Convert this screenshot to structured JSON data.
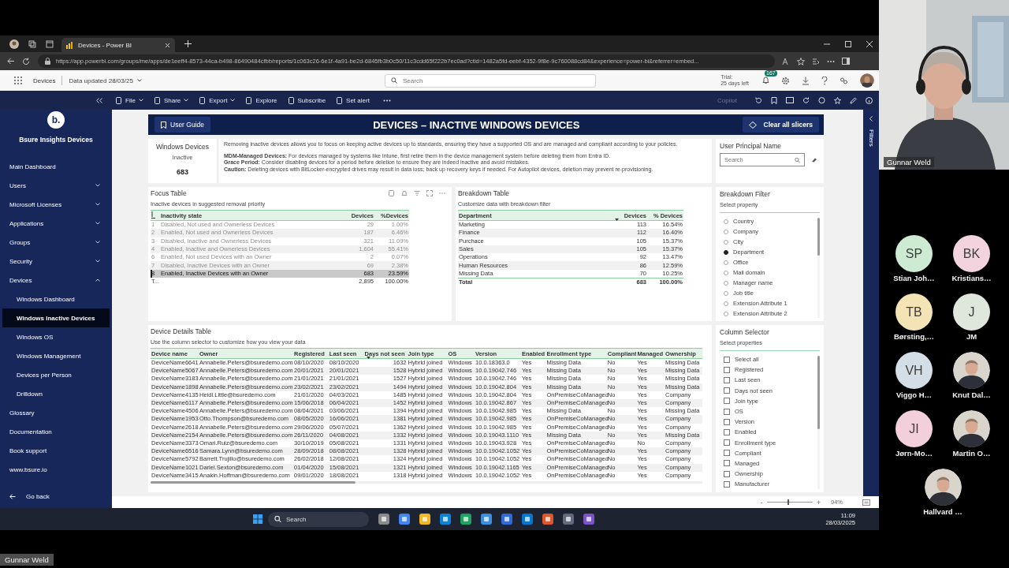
{
  "browser": {
    "tab_title": "Devices - Power BI",
    "url": "https://app.powerbi.com/groups/me/apps/de1eeff4-8573-44ca-b498-86490484cfbb/reports/1c063c26-6e1f-4a91-be2d-6845fb3b0c50/11c3cdd65f222b7ec0ad?ctid=1482a5fd-eebf-4352-9f8e-9c760088cd84&experience=power-bi&referrer=embed..."
  },
  "powerbi_header": {
    "app": "Devices",
    "data_updated": "Data updated 28/03/25",
    "search_placeholder": "Search",
    "trial": "Trial:",
    "trial_days": "25 days left",
    "notifications": "167"
  },
  "report_toolbar": {
    "items": [
      {
        "label": "File",
        "menu": true
      },
      {
        "label": "Share",
        "menu": true
      },
      {
        "label": "Export",
        "menu": true
      },
      {
        "label": "Explore",
        "menu": false
      },
      {
        "label": "Subscribe",
        "menu": false
      },
      {
        "label": "Set alert",
        "menu": false
      }
    ],
    "copilot": "Copilot"
  },
  "sidebar": {
    "brand_mark": "b.",
    "title": "Bsure Insights Devices",
    "items": [
      {
        "label": "Main Dashboard",
        "kind": "page",
        "selected": false
      },
      {
        "label": "Users",
        "kind": "section",
        "expanded": false
      },
      {
        "label": "Microsoft Licenses",
        "kind": "section",
        "expanded": false
      },
      {
        "label": "Applications",
        "kind": "section",
        "expanded": false
      },
      {
        "label": "Groups",
        "kind": "section",
        "expanded": false
      },
      {
        "label": "Security",
        "kind": "section",
        "expanded": false
      },
      {
        "label": "Devices",
        "kind": "section",
        "expanded": true,
        "children": [
          {
            "label": "Windows Dashboard",
            "selected": false
          },
          {
            "label": "Windows Inactive Devices",
            "selected": true
          },
          {
            "label": "Windows OS",
            "selected": false
          },
          {
            "label": "Windows Management",
            "selected": false
          },
          {
            "label": "Devices per Person",
            "selected": false
          },
          {
            "label": "Drilldown",
            "selected": false
          }
        ]
      },
      {
        "label": "Glossary",
        "kind": "page",
        "selected": false
      },
      {
        "label": "Documentation",
        "kind": "page",
        "selected": false
      },
      {
        "label": "Book support",
        "kind": "page",
        "selected": false
      },
      {
        "label": "www.bsure.io",
        "kind": "page",
        "selected": false
      }
    ],
    "back": "Go back"
  },
  "report": {
    "user_guide": "User Guide",
    "title": "DEVICES – INACTIVE WINDOWS DEVICES",
    "clear_slicers": "Clear all slicers",
    "filters": "Filters",
    "kpi": {
      "title": "Windows Devices",
      "subtitle": "Inactive",
      "value": "683"
    },
    "info": {
      "intro": "Removing inactive devices allows you to focus on keeping active devices up to standards, ensuring they have a supported OS and are managed and compliant according to your policies.",
      "notes": [
        "**MDM-Managed Devices:** For devices managed by systems like Intune, first retire them in the device management system before deleting them from Entra ID.",
        "**Grace Period:** Consider disabling devices for a period before deletion to ensure they are indeed inactive and avoid mistakes.",
        "**Caution:** Deleting devices with BitLocker-encrypted drives may result in data loss; back up recovery keys if needed.  For Autopilot devices, deletion may prevent re-provisioning."
      ]
    },
    "upn": {
      "title": "User Principal Name",
      "placeholder": "Search"
    },
    "focus_table": {
      "title": "Focus Table",
      "subtitle": "Inactive devices in suggested removal priority",
      "columns": [
        "Inactivity state",
        "Devices",
        "%Devices"
      ],
      "rows": [
        {
          "index": "1",
          "state": "Disabled, Not used and Ownerless Devices",
          "devices": "29",
          "pct": "1.00%",
          "selected": false
        },
        {
          "index": "2",
          "state": "Enabled, Not used and Ownerless Devices",
          "devices": "187",
          "pct": "6.46%",
          "selected": false
        },
        {
          "index": "3",
          "state": "Disabled, Inactive and Ownerless Devices",
          "devices": "321",
          "pct": "11.09%",
          "selected": false
        },
        {
          "index": "4",
          "state": "Enabled, Inactive and Ownerless Devices",
          "devices": "1,604",
          "pct": "55.41%",
          "selected": false
        },
        {
          "index": "6",
          "state": "Enabled, Not used Devices with an Owner",
          "devices": "2",
          "pct": "0.07%",
          "selected": false
        },
        {
          "index": "7",
          "state": "Disabled, Inactive Devices with an Owner",
          "devices": "69",
          "pct": "2.38%",
          "selected": false
        },
        {
          "index": "8",
          "state": "Enabled, Inactive Devices with an Owner",
          "devices": "683",
          "pct": "23.59%",
          "selected": true
        }
      ],
      "total": {
        "label": "T...",
        "devices": "2,895",
        "pct": "100.00%"
      }
    },
    "breakdown_table": {
      "title": "Breakdown Table",
      "subtitle": "Customize data with breakdown filter",
      "columns": [
        {
          "label": "Department",
          "sorted": false
        },
        {
          "label": "Devices",
          "sorted": true
        },
        {
          "label": "% Devices",
          "sorted": false
        }
      ],
      "rows": [
        [
          "Marketing",
          "113",
          "16.54%"
        ],
        [
          "Finance",
          "112",
          "16.40%"
        ],
        [
          "Purchace",
          "105",
          "15.37%"
        ],
        [
          "Sales",
          "105",
          "15.37%"
        ],
        [
          "Operations",
          "92",
          "13.47%"
        ],
        [
          "Human Resources",
          "86",
          "12.59%"
        ],
        [
          "Missing Data",
          "70",
          "10.25%"
        ]
      ],
      "total": [
        "Total",
        "683",
        "100.00%"
      ]
    },
    "breakdown_filter": {
      "title": "Breakdown Filter",
      "subtitle": "Select property",
      "options": [
        {
          "label": "Country",
          "selected": false
        },
        {
          "label": "Company",
          "selected": false
        },
        {
          "label": "City",
          "selected": false
        },
        {
          "label": "Department",
          "selected": true
        },
        {
          "label": "Office",
          "selected": false
        },
        {
          "label": "Mail domain",
          "selected": false
        },
        {
          "label": "Manager name",
          "selected": false
        },
        {
          "label": "Job title",
          "selected": false
        },
        {
          "label": "Extension Attribute 1",
          "selected": false
        },
        {
          "label": "Extension Attribute 2",
          "selected": false
        }
      ]
    },
    "details_table": {
      "title": "Device Details Table",
      "subtitle": "Use the column selector to customize how you view your data",
      "columns": [
        {
          "label": "Device name",
          "sorted": false
        },
        {
          "label": "Owner",
          "sorted": false
        },
        {
          "label": "Registered",
          "sorted": false
        },
        {
          "label": "Last seen",
          "sorted": false
        },
        {
          "label": "Days not seen",
          "sorted": true
        },
        {
          "label": "Join type",
          "sorted": false
        },
        {
          "label": "OS",
          "sorted": false
        },
        {
          "label": "Version",
          "sorted": false
        },
        {
          "label": "Enabled",
          "sorted": false
        },
        {
          "label": "Enrollment type",
          "sorted": false
        },
        {
          "label": "Compliant",
          "sorted": false
        },
        {
          "label": "Managed",
          "sorted": false
        },
        {
          "label": "Ownership",
          "sorted": false
        }
      ],
      "rows": [
        [
          "DeviceName6641",
          "Annabelle.Peters@bsuredemo.com",
          "08/10/2020",
          "08/10/2020",
          "1632",
          "Hybrid joined",
          "Windows",
          "10.0.18363.0",
          "Yes",
          "Missing Data",
          "No",
          "Yes",
          "Missing Data"
        ],
        [
          "DeviceName5067",
          "Annabelle.Peters@bsuredemo.com",
          "20/01/2021",
          "20/01/2021",
          "1528",
          "Hybrid joined",
          "Windows",
          "10.0.19042.746",
          "Yes",
          "Missing Data",
          "No",
          "Yes",
          "Missing Data"
        ],
        [
          "DeviceName3183",
          "Annabelle.Peters@bsuredemo.com",
          "21/01/2021",
          "21/01/2021",
          "1527",
          "Hybrid joined",
          "Windows",
          "10.0.19042.746",
          "Yes",
          "Missing Data",
          "No",
          "Yes",
          "Missing Data"
        ],
        [
          "DeviceName1898",
          "Annabelle.Peters@bsuredemo.com",
          "23/02/2021",
          "23/02/2021",
          "1494",
          "Hybrid joined",
          "Windows",
          "10.0.19042.804",
          "Yes",
          "Missing Data",
          "No",
          "Yes",
          "Missing Data"
        ],
        [
          "DeviceName4135",
          "Heidi.Little@bsuredemo.com",
          "21/01/2020",
          "04/03/2021",
          "1485",
          "Hybrid joined",
          "Windows",
          "10.0.19042.804",
          "Yes",
          "OnPremiseCoManaged",
          "No",
          "Yes",
          "Company"
        ],
        [
          "DeviceName6117",
          "Annabelle.Peters@bsuredemo.com",
          "15/06/2018",
          "06/04/2021",
          "1452",
          "Hybrid joined",
          "Windows",
          "10.0.19042.867",
          "Yes",
          "OnPremiseCoManaged",
          "No",
          "Yes",
          "Company"
        ],
        [
          "DeviceName4506",
          "Annabelle.Peters@bsuredemo.com",
          "08/04/2021",
          "03/06/2021",
          "1394",
          "Hybrid joined",
          "Windows",
          "10.0.19042.985",
          "Yes",
          "Missing Data",
          "No",
          "Yes",
          "Missing Data"
        ],
        [
          "DeviceName1953",
          "Otto.Thompson@bsuredemo.com",
          "08/05/2020",
          "16/06/2021",
          "1381",
          "Hybrid joined",
          "Windows",
          "10.0.19042.985",
          "Yes",
          "OnPremiseCoManaged",
          "No",
          "Yes",
          "Company"
        ],
        [
          "DeviceName2618",
          "Annabelle.Peters@bsuredemo.com",
          "29/06/2020",
          "05/07/2021",
          "1362",
          "Hybrid joined",
          "Windows",
          "10.0.19042.985",
          "Yes",
          "OnPremiseCoManaged",
          "No",
          "Yes",
          "Company"
        ],
        [
          "DeviceName2154",
          "Annabelle.Peters@bsuredemo.com",
          "26/11/2020",
          "04/08/2021",
          "1332",
          "Hybrid joined",
          "Windows",
          "10.0.19043.1110",
          "Yes",
          "Missing Data",
          "No",
          "Yes",
          "Missing Data"
        ],
        [
          "DeviceName3373",
          "Omari.Ruiz@bsuredemo.com",
          "30/10/2019",
          "05/08/2021",
          "1331",
          "Hybrid joined",
          "Windows",
          "10.0.19043.928",
          "Yes",
          "OnPremiseCoManaged",
          "No",
          "No",
          "Company"
        ],
        [
          "DeviceName6516",
          "Samara.Lynn@bsuredemo.com",
          "28/09/2018",
          "08/08/2021",
          "1328",
          "Hybrid joined",
          "Windows",
          "10.0.19042.1052",
          "Yes",
          "OnPremiseCoManaged",
          "No",
          "Yes",
          "Company"
        ],
        [
          "DeviceName5792",
          "Barrett.Trujillo@bsuredemo.com",
          "26/02/2018",
          "12/08/2021",
          "1324",
          "Hybrid joined",
          "Windows",
          "10.0.19042.1052",
          "Yes",
          "OnPremiseCoManaged",
          "No",
          "Yes",
          "Company"
        ],
        [
          "DeviceName1021",
          "Dariel.Sexton@bsuredemo.com",
          "01/04/2020",
          "15/08/2021",
          "1321",
          "Hybrid joined",
          "Windows",
          "10.0.19042.1165",
          "Yes",
          "OnPremiseCoManaged",
          "No",
          "Yes",
          "Company"
        ],
        [
          "DeviceName3415",
          "Anakin.Hoffman@bsuredemo.com",
          "09/01/2020",
          "18/08/2021",
          "1318",
          "Hybrid joined",
          "Windows",
          "10.0.19042.1052",
          "Yes",
          "OnPremiseCoManaged",
          "No",
          "Yes",
          "Company"
        ]
      ]
    },
    "column_selector": {
      "title": "Column Selector",
      "subtitle": "Select properties",
      "options": [
        {
          "label": "Select all",
          "checked": false
        },
        {
          "label": "Registered",
          "checked": false
        },
        {
          "label": "Last seen",
          "checked": false
        },
        {
          "label": "Days not seen",
          "checked": false
        },
        {
          "label": "Join type",
          "checked": false
        },
        {
          "label": "OS",
          "checked": false
        },
        {
          "label": "Version",
          "checked": false
        },
        {
          "label": "Enabled",
          "checked": false
        },
        {
          "label": "Enrollment type",
          "checked": false
        },
        {
          "label": "Compliant",
          "checked": false
        },
        {
          "label": "Managed",
          "checked": false
        },
        {
          "label": "Ownership",
          "checked": false
        },
        {
          "label": "Manufacturer",
          "checked": false
        }
      ]
    },
    "zoom": {
      "minus": "-",
      "plus": "+",
      "level": 0.45,
      "reading": "94%"
    }
  },
  "taskbar": {
    "search_placeholder": "Search",
    "time": "11:09",
    "date": "28/03/2025"
  },
  "meeting": {
    "presenter": "Gunnar Weld",
    "self_label": "Gunnar Weld",
    "participants": [
      {
        "kind": "initials",
        "initials": "SP",
        "name": "Stian Joh…",
        "color": "#cdebd2"
      },
      {
        "kind": "initials",
        "initials": "BK",
        "name": "Kristians…",
        "color": "#f2d3de"
      },
      {
        "kind": "initials",
        "initials": "TB",
        "name": "Børsting,…",
        "color": "#f3e3b5"
      },
      {
        "kind": "initials",
        "initials": "J",
        "name": "JM",
        "color": "#dfe6db"
      },
      {
        "kind": "initials",
        "initials": "VH",
        "name": "Viggo H…",
        "color": "#d3dee6"
      },
      {
        "name": "Knut Dal…"
      },
      {
        "kind": "initials",
        "initials": "JI",
        "name": "Jørn-Mo…",
        "color": "#f3cfdb"
      },
      {
        "name": "Martin O…"
      },
      {
        "name": "Hallvard …"
      }
    ]
  }
}
